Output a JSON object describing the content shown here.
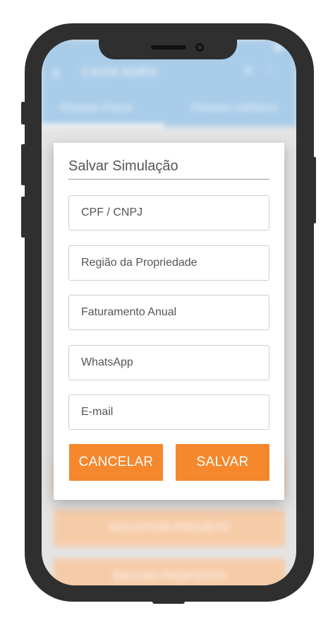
{
  "app": {
    "title": "CAIXA AGRO",
    "tabs": [
      "PESSOA FÍSICA",
      "PESSOA JURÍDICA"
    ]
  },
  "background_buttons": [
    "SOLICITAR PROJETO",
    "ENVIAR PROPOSTA"
  ],
  "dialog": {
    "title": "Salvar Simulação",
    "fields": {
      "cpf": "CPF / CNPJ",
      "regiao": "Região da Propriedade",
      "faturamento": "Faturamento Anual",
      "whatsapp": "WhatsApp",
      "email": "E-mail"
    },
    "cancel_label": "CANCELAR",
    "save_label": "SALVAR"
  },
  "colors": {
    "accent": "#f5872c",
    "appbar": "#a9cce9",
    "phone": "#2f2f2f"
  }
}
